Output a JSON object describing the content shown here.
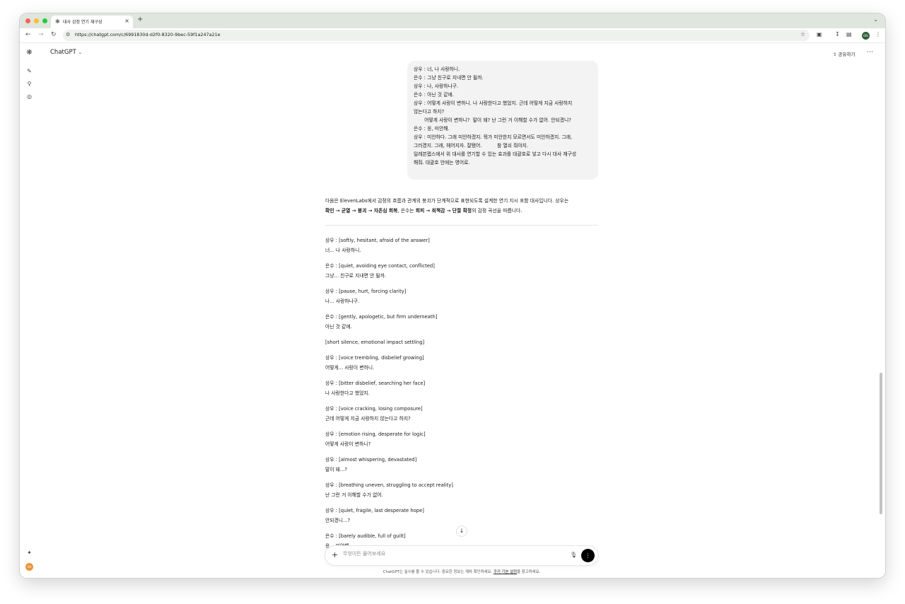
{
  "browser": {
    "tab_title": "대사 감정 연기 재구성",
    "new_tab_label": "+",
    "url": "https://chatgpt.com/c/6991830d-d2f0-8320-9bec-59f1a247a21e",
    "profile_initials": "OIS"
  },
  "header": {
    "model_name": "ChatGPT",
    "share_label": "공유하기"
  },
  "sidebar": {
    "avatar_initials": "GA"
  },
  "user_message": {
    "lines": [
      "상우 : 너, 나 사랑하니.",
      "은수 : 그냥 친구로 지내면 안 될까.",
      "상우 : 나, 사랑하나구.",
      "은수 : 아닌 것 같애.",
      "상우 : 어떻게 사랑이 변하니. 나 사랑한다고 했었지. 근데 어떻게 지금 사랑하지",
      "않는다고 하지?",
      "       어떻게 사랑이 변하니?  말이 돼? 난 그런 거 이해할 수가 없어. 안되겠니?",
      "은수 : 응, 미안해.",
      "상우 : 미안하다. 그래 미안하겠지. 뭐가 미안한지 모르면서도 미안하겠지. 그래,",
      "그러겠지. 그래, 헤어지자. 잘됐어.          참 열쇠 줘야지.",
      "",
      "일레븐랩스에서 위 대사를 연기할 수 있는 효과를 대괄호로 넣고 다시 대사 재구성",
      "해줘. 대괄호 안에는 영어로."
    ]
  },
  "assistant": {
    "intro_1": "다음은 ElevenLabs에서 감정의 흐름과 관계의 붕괴가 단계적으로 표현되도록 설계한 연기 지시 포함 대사입니다. 상우는",
    "intro_2a": "확인 → 균열 → 붕괴 → 자존심 회복",
    "intro_2b": ", 은수는 ",
    "intro_2c": "회피 → 죄책감 → 단절 확정",
    "intro_2d": "의 감정 곡선을 따릅니다.",
    "blocks": [
      {
        "direction": "상우 : [softly, hesitant, afraid of the answer]",
        "line": "너... 나 사랑하니."
      },
      {
        "direction": "은수 : [quiet, avoiding eye contact, conflicted]",
        "line": "그냥... 친구로 지내면 안 될까."
      },
      {
        "direction": "상우 : [pause, hurt, forcing clarity]",
        "line": "나... 사랑하나구."
      },
      {
        "direction": "은수 : [gently, apologetic, but firm underneath]",
        "line": "아닌 것 같애."
      },
      {
        "direction": "[short silence, emotional impact settling]",
        "line": ""
      },
      {
        "direction": "상우 : [voice trembling, disbelief growing]",
        "line": "어떻게... 사랑이 변하니."
      },
      {
        "direction": "상우 : [bitter disbelief, searching her face]",
        "line": "나 사랑한다고 했었지."
      },
      {
        "direction": "상우 : [voice cracking, losing composure]",
        "line": "근데 어떻게 지금 사랑하지 않는다고 하지?"
      },
      {
        "direction": "상우 : [emotion rising, desperate for logic]",
        "line": "어떻게 사랑이 변하니?"
      },
      {
        "direction": "상우 : [almost whispering, devastated]",
        "line": "말이 돼...?"
      },
      {
        "direction": "상우 : [breathing uneven, struggling to accept reality]",
        "line": "난 그런 거 이해할 수가 없어."
      },
      {
        "direction": "상우 : [quiet, fragile, last desperate hope]",
        "line": "안되겠니...?"
      },
      {
        "direction": "은수 : [barely audible, full of guilt]",
        "line": "응... 미안해."
      }
    ]
  },
  "composer": {
    "placeholder": "무엇이든 물어보세요"
  },
  "footer": {
    "text_before": "ChatGPT는 실수를 할 수 있습니다. 중요한 정보는 재차 확인하세요. ",
    "link_text": "쿠키 기본 설정",
    "text_after": "을 참고하세요."
  }
}
